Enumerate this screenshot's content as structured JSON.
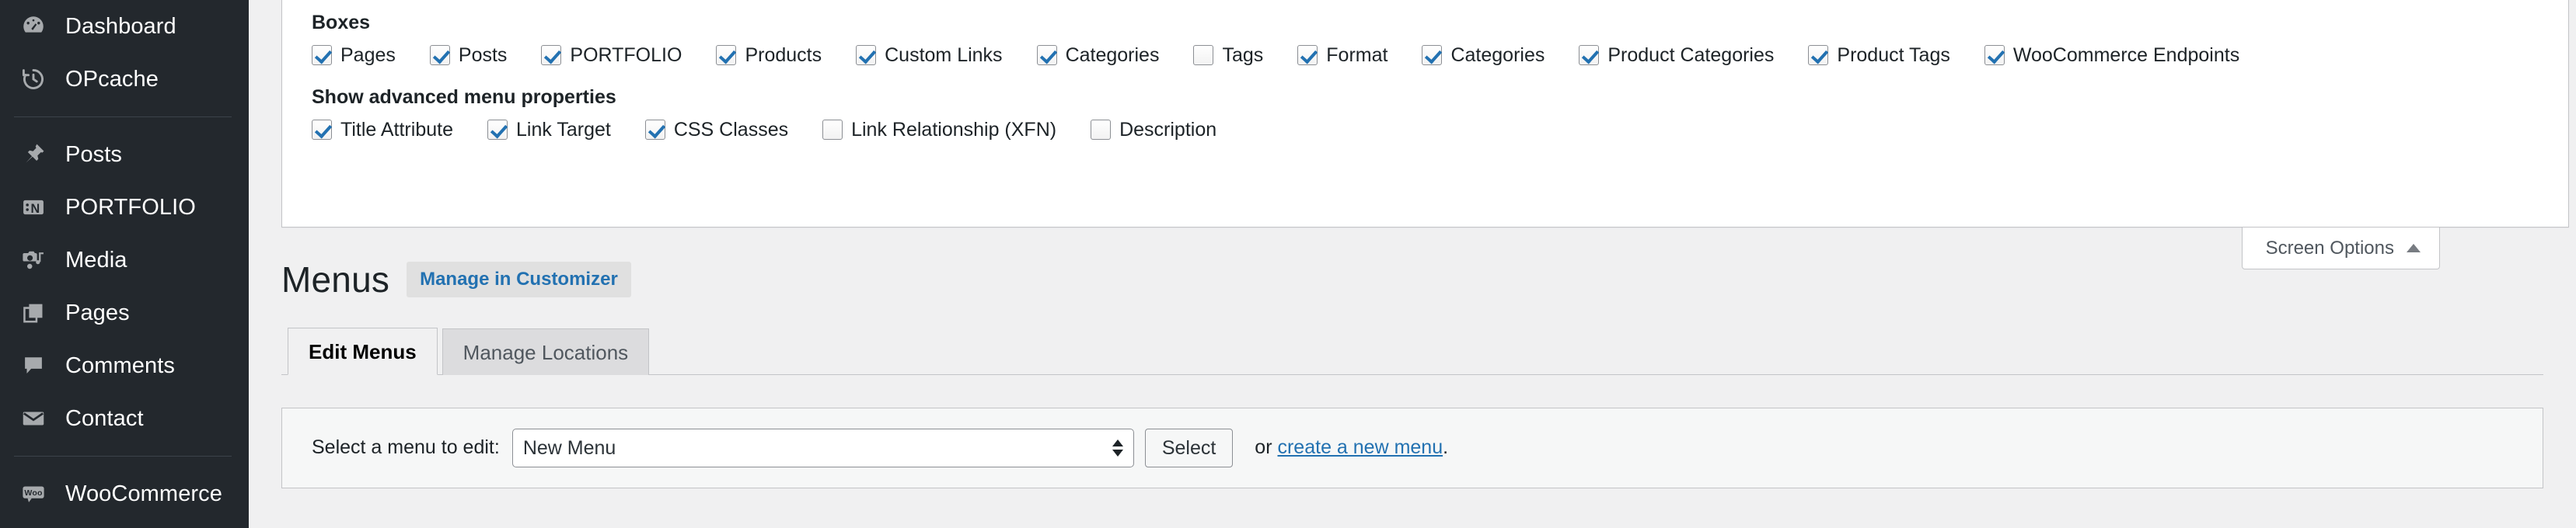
{
  "sidebar": {
    "items": [
      {
        "label": "Dashboard",
        "icon": "dashboard-icon"
      },
      {
        "label": "OPcache",
        "icon": "opcache-clock-icon"
      },
      {
        "separator": true
      },
      {
        "label": "Posts",
        "icon": "pin-icon"
      },
      {
        "label": "PORTFOLIO",
        "icon": "portfolio-icon"
      },
      {
        "label": "Media",
        "icon": "media-camera-icon"
      },
      {
        "label": "Pages",
        "icon": "pages-icon"
      },
      {
        "label": "Comments",
        "icon": "comments-icon"
      },
      {
        "label": "Contact",
        "icon": "envelope-icon"
      },
      {
        "separator": true
      },
      {
        "label": "WooCommerce",
        "icon": "woo-icon"
      }
    ]
  },
  "screen_options": {
    "tab_label": "Screen Options",
    "tab_caret": "caret-up-icon",
    "boxes_legend": "Boxes",
    "boxes": [
      {
        "label": "Pages",
        "checked": true
      },
      {
        "label": "Posts",
        "checked": true
      },
      {
        "label": "PORTFOLIO",
        "checked": true
      },
      {
        "label": "Products",
        "checked": true
      },
      {
        "label": "Custom Links",
        "checked": true
      },
      {
        "label": "Categories",
        "checked": true
      },
      {
        "label": "Tags",
        "checked": false
      },
      {
        "label": "Format",
        "checked": true
      },
      {
        "label": "Categories",
        "checked": true
      },
      {
        "label": "Product Categories",
        "checked": true
      },
      {
        "label": "Product Tags",
        "checked": true
      },
      {
        "label": "WooCommerce Endpoints",
        "checked": true
      }
    ],
    "advanced_legend": "Show advanced menu properties",
    "advanced": [
      {
        "label": "Title Attribute",
        "checked": true
      },
      {
        "label": "Link Target",
        "checked": true
      },
      {
        "label": "CSS Classes",
        "checked": true
      },
      {
        "label": "Link Relationship (XFN)",
        "checked": false
      },
      {
        "label": "Description",
        "checked": false
      }
    ]
  },
  "main": {
    "page_title": "Menus",
    "manage_in_customizer": "Manage in Customizer",
    "tabs": [
      {
        "label": "Edit Menus",
        "active": true
      },
      {
        "label": "Manage Locations",
        "active": false
      }
    ],
    "select_menu": {
      "label": "Select a menu to edit:",
      "selected_value": "New Menu",
      "options": [
        "New Menu"
      ],
      "submit_label": "Select",
      "or_prefix": "or ",
      "create_link": "create a new menu",
      "or_suffix": "."
    }
  },
  "colors": {
    "sidebar_bg": "#23282d",
    "accent_link": "#2271b1",
    "page_bg": "#f0f0f1",
    "panel_bg": "#ffffff",
    "checkbox_check": "#2271b1"
  }
}
